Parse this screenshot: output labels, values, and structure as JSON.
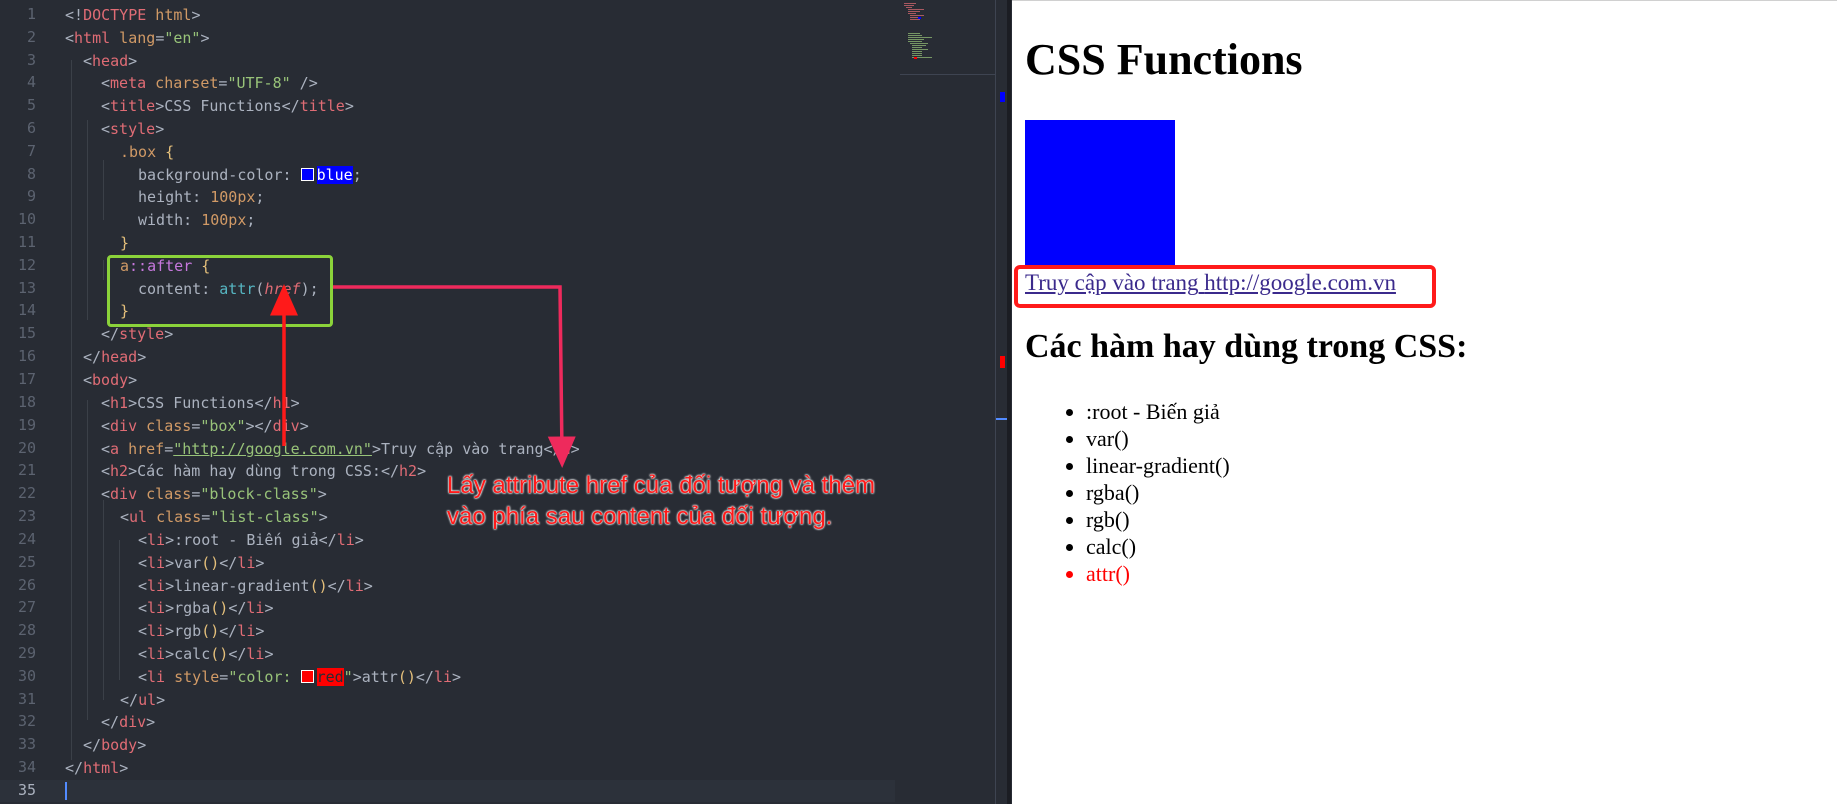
{
  "editor": {
    "line_numbers": [
      "1",
      "2",
      "3",
      "4",
      "5",
      "6",
      "7",
      "8",
      "9",
      "10",
      "11",
      "12",
      "13",
      "14",
      "15",
      "16",
      "17",
      "18",
      "19",
      "20",
      "21",
      "22",
      "23",
      "24",
      "25",
      "26",
      "27",
      "28",
      "29",
      "30",
      "31",
      "32",
      "33",
      "34",
      "35"
    ]
  },
  "code": {
    "l1": {
      "open": "<!",
      "tag": "DOCTYPE",
      "rest": " html",
      "close": ">"
    },
    "l2": {
      "open": "<",
      "tag": "html",
      "attr": " lang",
      "eq": "=",
      "val": "\"en\"",
      "close": ">"
    },
    "l3": {
      "open": "<",
      "tag": "head",
      "close": ">"
    },
    "l4": {
      "open": "<",
      "tag": "meta",
      "attr": " charset",
      "eq": "=",
      "val": "\"UTF-8\"",
      "close": " />"
    },
    "l5": {
      "open": "<",
      "tag": "title",
      "mid": ">CSS Functions</",
      "tag2": "title",
      "close": ">"
    },
    "l6": {
      "open": "<",
      "tag": "style",
      "close": ">"
    },
    "l7": {
      "sel": ".box",
      "brace": " {"
    },
    "l8": {
      "prop": "background-color: ",
      "val": "blue",
      "end": ";",
      "swatch": "#0000ff"
    },
    "l9": {
      "prop": "height: ",
      "val": "100px",
      "end": ";"
    },
    "l10": {
      "prop": "width: ",
      "val": "100px",
      "end": ";"
    },
    "l11": {
      "brace": "}"
    },
    "l12": {
      "sel": "a",
      "pseudo": "::after",
      "brace": " {"
    },
    "l13": {
      "prop": "content: ",
      "fn": "attr",
      "p1": "(",
      "arg": "href",
      "p2": ")",
      "end": ";"
    },
    "l14": {
      "brace": "}"
    },
    "l15": {
      "open": "</",
      "tag": "style",
      "close": ">"
    },
    "l16": {
      "open": "</",
      "tag": "head",
      "close": ">"
    },
    "l17": {
      "open": "<",
      "tag": "body",
      "close": ">"
    },
    "l18": {
      "open": "<",
      "tag": "h1",
      "mid": ">CSS Functions</",
      "tag2": "h1",
      "close": ">"
    },
    "l19": {
      "open": "<",
      "tag": "div",
      "attr": " class",
      "eq": "=",
      "val": "\"box\"",
      "mid": "></",
      "tag2": "div",
      "close": ">"
    },
    "l20": {
      "open": "<",
      "tag": "a",
      "attr": " href",
      "eq": "=",
      "val": "\"http://google.com.vn\"",
      "mid": ">Truy cập vào trang</",
      "tag2": "a",
      "close": ">"
    },
    "l21": {
      "open": "<",
      "tag": "h2",
      "mid": ">Các hàm hay dùng trong CSS:</",
      "tag2": "h2",
      "close": ">"
    },
    "l22": {
      "open": "<",
      "tag": "div",
      "attr": " class",
      "eq": "=",
      "val": "\"block-class\"",
      "close": ">"
    },
    "l23": {
      "open": "<",
      "tag": "ul",
      "attr": " class",
      "eq": "=",
      "val": "\"list-class\"",
      "close": ">"
    },
    "l24": {
      "open": "<",
      "tag": "li",
      "mid": ">:root - Biến giả</",
      "tag2": "li",
      "close": ">"
    },
    "l25": {
      "open": "<",
      "tag": "li",
      "mid": ">var",
      "paren": "()",
      "mid2": "</",
      "tag2": "li",
      "close": ">"
    },
    "l26": {
      "open": "<",
      "tag": "li",
      "mid": ">linear-gradient",
      "paren": "()",
      "mid2": "</",
      "tag2": "li",
      "close": ">"
    },
    "l27": {
      "open": "<",
      "tag": "li",
      "mid": ">rgba",
      "paren": "()",
      "mid2": "</",
      "tag2": "li",
      "close": ">"
    },
    "l28": {
      "open": "<",
      "tag": "li",
      "mid": ">rgb",
      "paren": "()",
      "mid2": "</",
      "tag2": "li",
      "close": ">"
    },
    "l29": {
      "open": "<",
      "tag": "li",
      "mid": ">calc",
      "paren": "()",
      "mid2": "</",
      "tag2": "li",
      "close": ">"
    },
    "l30": {
      "open": "<",
      "tag": "li",
      "attr": " style",
      "eq": "=",
      "q1": "\"color: ",
      "val": "red",
      "q2": "\"",
      "mid": ">attr",
      "paren": "()",
      "mid2": "</",
      "tag2": "li",
      "close": ">",
      "swatch": "#ff0000"
    },
    "l31": {
      "open": "</",
      "tag": "ul",
      "close": ">"
    },
    "l32": {
      "open": "</",
      "tag": "div",
      "close": ">"
    },
    "l33": {
      "open": "</",
      "tag": "body",
      "close": ">"
    },
    "l34": {
      "open": "</",
      "tag": "html",
      "close": ">"
    }
  },
  "preview": {
    "h1": "CSS Functions",
    "link_text": "Truy cập vào trang",
    "link_after": "http://google.com.vn",
    "h2": "Các hàm hay dùng trong CSS:",
    "list": [
      ":root - Biến giả",
      "var()",
      "linear-gradient()",
      "rgba()",
      "rgb()",
      "calc()",
      "attr()"
    ]
  },
  "annotation": {
    "line1": "Lấy attribute href của đối tượng và thêm",
    "line2": "vào phía sau content của đối tượng.",
    "green_box_color": "#8bd33a",
    "red_color": "#ff1a1a"
  },
  "colors": {
    "editor_bg": "#282c34",
    "tag": "#e06c75",
    "attr": "#d19a66",
    "string": "#98c379",
    "preview_box": "#0000ff",
    "list_last": "#ff0000"
  }
}
